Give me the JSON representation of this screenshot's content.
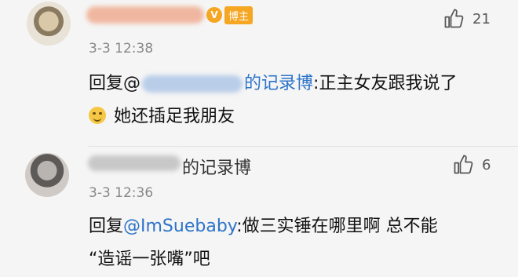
{
  "comments": [
    {
      "badge": "博主",
      "badge_icon": "V",
      "time": "3-3 12:38",
      "likes": "21",
      "reply_prefix": "回复@",
      "mention_suffix": "的记录博",
      "colon_text": ":正主女友跟我说了",
      "line2": "她还插足我朋友"
    },
    {
      "name_suffix": "的记录博",
      "time": "3-3 12:36",
      "likes": "6",
      "line1_prefix": "回复",
      "mention": "@ImSuebaby",
      "line1_rest": ":做三实锤在哪里啊 总不能",
      "line2": "“造谣一张嘴”吧"
    }
  ],
  "icons": [
    "thumbs-up-icon",
    "smile-emoji-icon",
    "verified-v-icon"
  ]
}
